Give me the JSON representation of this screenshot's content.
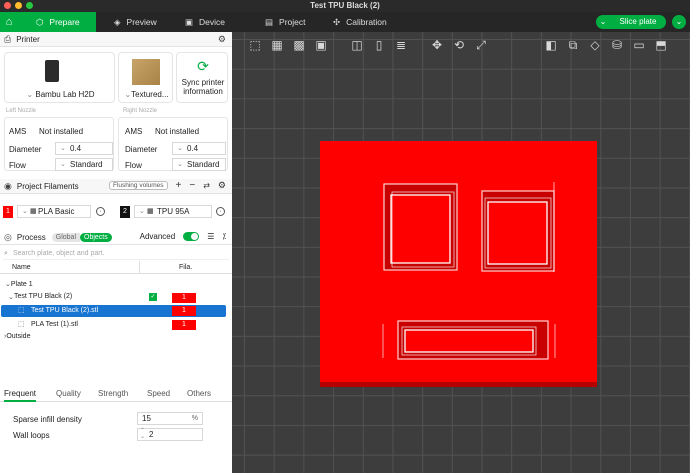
{
  "window": {
    "title": "Test TPU Black (2)"
  },
  "nav": {
    "tabs": [
      {
        "label": "Prepare",
        "icon": "cube-icon"
      },
      {
        "label": "Preview",
        "icon": "layers-icon"
      },
      {
        "label": "Device",
        "icon": "device-icon"
      },
      {
        "label": "Project",
        "icon": "project-icon"
      },
      {
        "label": "Calibration",
        "icon": "calibration-icon"
      }
    ],
    "slice_label": "Slice plate"
  },
  "printer": {
    "section_title": "Printer",
    "printer_name": "Bambu Lab H2D",
    "plate_name": "Textured...",
    "sync_label_1": "Sync printer",
    "sync_label_2": "information",
    "left_nozzle_label": "Left Nozzle",
    "right_nozzle_label": "Right Nozzle",
    "left": {
      "ams_label": "AMS",
      "ams_value": "Not installed",
      "diameter_label": "Diameter",
      "diameter_value": "0.4",
      "flow_label": "Flow",
      "flow_value": "Standard"
    },
    "right": {
      "ams_label": "AMS",
      "ams_value": "Not installed",
      "diameter_label": "Diameter",
      "diameter_value": "0.4",
      "flow_label": "Flow",
      "flow_value": "Standard"
    }
  },
  "filaments": {
    "section_title": "Project Filaments",
    "flushing_label": "Flushing volumes",
    "items": [
      {
        "index": "1",
        "name": "PLA Basic",
        "color": "#ff0000"
      },
      {
        "index": "2",
        "name": "TPU 95A",
        "color": "#111111"
      }
    ]
  },
  "process": {
    "section_title": "Process",
    "global_label": "Global",
    "objects_label": "Objects",
    "advanced_label": "Advanced",
    "advanced_on": true,
    "search_placeholder": "Search plate, object and part."
  },
  "object_list": {
    "col_name": "Name",
    "col_fila": "Fila.",
    "rows": [
      {
        "label": "Plate 1",
        "fila": ""
      },
      {
        "label": "Test TPU Black (2)",
        "fila": "1"
      },
      {
        "label": "Test TPU Black (2).stl",
        "fila": "1"
      },
      {
        "label": "PLA Test (1).stl",
        "fila": "1"
      },
      {
        "label": "Outside",
        "fila": ""
      }
    ]
  },
  "settings_tabs": [
    "Frequent",
    "Quality",
    "Strength",
    "Speed",
    "Others"
  ],
  "settings": {
    "infill_label": "Sparse infill density",
    "infill_value": "15",
    "infill_unit": "%",
    "walls_label": "Wall loops",
    "walls_value": "2"
  },
  "colors": {
    "accent": "#00ae42",
    "model": "#ff0000",
    "selected_row": "#1874d1"
  }
}
